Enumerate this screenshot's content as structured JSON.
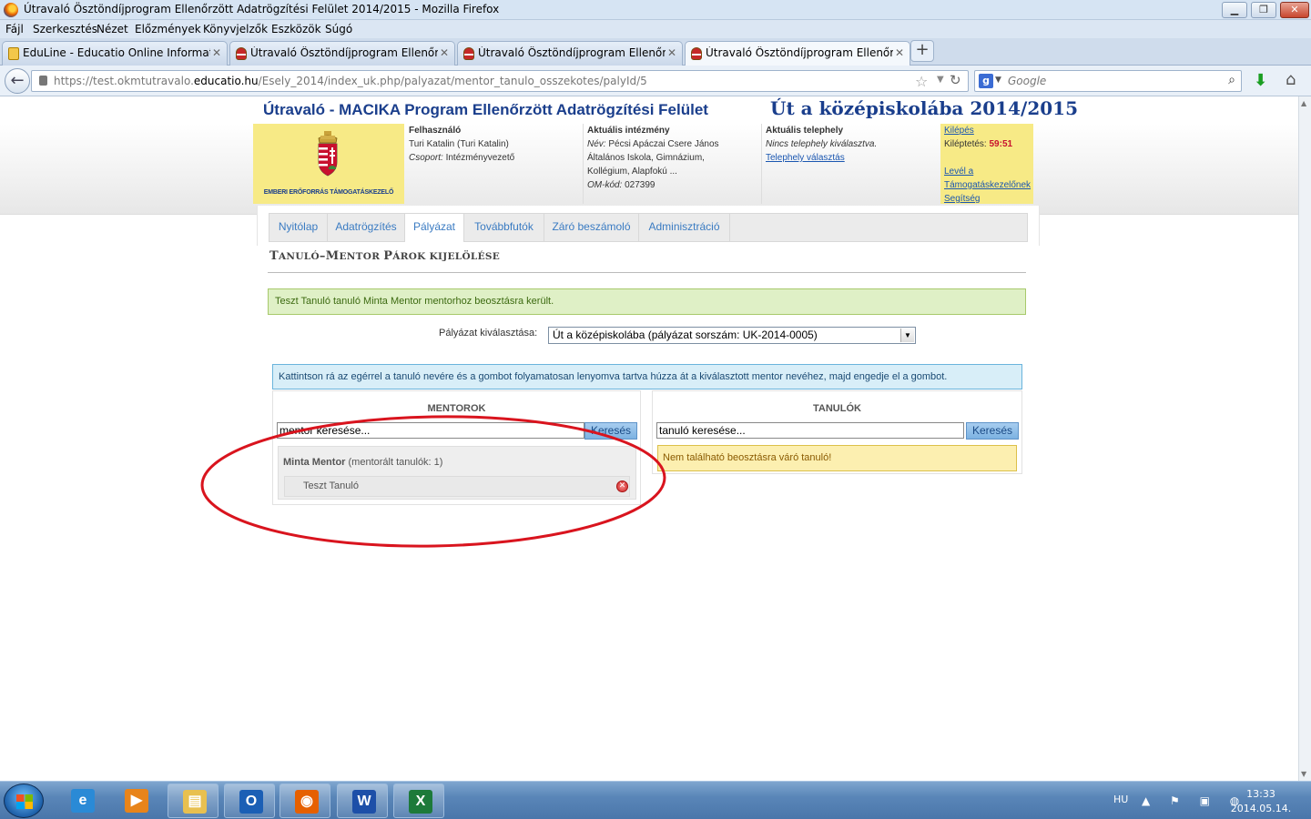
{
  "window": {
    "title": "Útravaló Ösztöndíjprogram Ellenőrzött Adatrögzítési Felület 2014/2015 - Mozilla Firefox",
    "min_label": "▁",
    "max_label": "❐",
    "close_label": "✕"
  },
  "menu": [
    "Fájl",
    "Szerkesztés",
    "Nézet",
    "Előzmények",
    "Könyvjelzők",
    "Eszközök",
    "Súgó"
  ],
  "tabs": [
    {
      "label": "EduLine - Educatio Online Informatik...",
      "icon": "eduline-favicon",
      "close": "✕"
    },
    {
      "label": "Útravaló Ösztöndíjprogram Ellenőrzöt...",
      "icon": "crest-favicon",
      "close": "✕"
    },
    {
      "label": "Útravaló Ösztöndíjprogram Ellenőrzöt...",
      "icon": "crest-favicon",
      "close": "✕"
    },
    {
      "label": "Útravaló Ösztöndíjprogram Ellenőrzöt...",
      "icon": "crest-favicon",
      "close": "✕",
      "active": true
    }
  ],
  "new_tab_label": "+",
  "address": {
    "prefix": "https://test.okmtutravalo.",
    "domain": "educatio.hu",
    "path": "/Esely_2014/index_uk.php/palyazat/mentor_tanulo_osszekotes/palyId/5"
  },
  "search": {
    "placeholder": "Google",
    "engine_letter": "g"
  },
  "site": {
    "title": "Útravaló - MACIKA Program Ellenőrzött Adatrögzítési Felület",
    "program": "Út a középiskolába 2014/2015",
    "logo_text": "EMBERI ERŐFORRÁS TÁMOGATÁSKEZELŐ"
  },
  "user": {
    "heading": "Felhasználó",
    "name": "Turi Katalin (Turi Katalin)",
    "group_label": "Csoport:",
    "group": "Intézményvezető"
  },
  "institution": {
    "heading": "Aktuális intézmény",
    "name_label": "Név:",
    "name_line1": "Pécsi Apáczai Csere János",
    "name_line2": "Általános Iskola, Gimnázium,",
    "name_line3": "Kollégium, Alapfokú ...",
    "om_label": "OM-kód:",
    "om_code": "027399"
  },
  "site_location": {
    "heading": "Aktuális telephely",
    "none_text": "Nincs telephely kiválasztva.",
    "choose_link": "Telephely választás"
  },
  "links": {
    "logout": "Kilépés",
    "logout_timer_label": "Kiléptetés:",
    "logout_timer": "59:51",
    "letter_line1": "Levél a",
    "letter_line2": "Támogatáskezelőnek",
    "help": "Segítség"
  },
  "nav": [
    {
      "label": "Nyitólap"
    },
    {
      "label": "Adatrögzítés"
    },
    {
      "label": "Pályázat",
      "active": true
    },
    {
      "label": "Továbbfutók"
    },
    {
      "label": "Záró beszámoló"
    },
    {
      "label": "Adminisztráció"
    }
  ],
  "page": {
    "heading_first": "T",
    "heading_rest_1": "ANULÓ",
    "heading_dash": "–",
    "heading_first_2": "M",
    "heading_rest_2": "ENTOR ",
    "heading_first_3": "P",
    "heading_rest_3": "ÁROK KIJELÖLÉSE",
    "success_message": "Teszt Tanuló tanuló Minta Mentor mentorhoz beosztásra került.",
    "select_label": "Pályázat kiválasztása:",
    "select_value": "Út a középiskolába (pályázat sorszám: UK-2014-0005)",
    "info_message": "Kattintson rá az egérrel a tanuló nevére és a gombot folyamatosan lenyomva tartva húzza át a kiválasztott mentor nevéhez, majd engedje el a gombot."
  },
  "mentors": {
    "title": "MENTOROK",
    "search_value": "mentor keresése...",
    "search_button": "Keresés",
    "card": {
      "name": "Minta Mentor",
      "count_text": "(mentorált tanulók: 1)",
      "student": "Teszt Tanuló",
      "remove_glyph": "✕"
    }
  },
  "students": {
    "title": "TANULÓK",
    "search_value": "tanuló keresése...",
    "search_button": "Keresés",
    "empty_message": "Nem található beosztásra váró tanuló!"
  },
  "annotation_color": "#d9141e",
  "taskbar": {
    "icons": [
      {
        "name": "ie-icon",
        "glyph": "e",
        "color": "#2a8ad6"
      },
      {
        "name": "media-player-icon",
        "glyph": "▶",
        "color": "#e8841a"
      },
      {
        "name": "explorer-icon",
        "glyph": "▤",
        "color": "#e8c050"
      },
      {
        "name": "outlook-icon",
        "glyph": "O",
        "color": "#1b5fb5"
      },
      {
        "name": "firefox-icon",
        "glyph": "◉",
        "color": "#e66000"
      },
      {
        "name": "word-icon",
        "glyph": "W",
        "color": "#1d4fa8"
      },
      {
        "name": "excel-icon",
        "glyph": "X",
        "color": "#1d7a3a"
      }
    ],
    "lang": "HU",
    "tray": "▲ ⚑ ▣ ◍",
    "time": "13:33",
    "date": "2014.05.14."
  }
}
